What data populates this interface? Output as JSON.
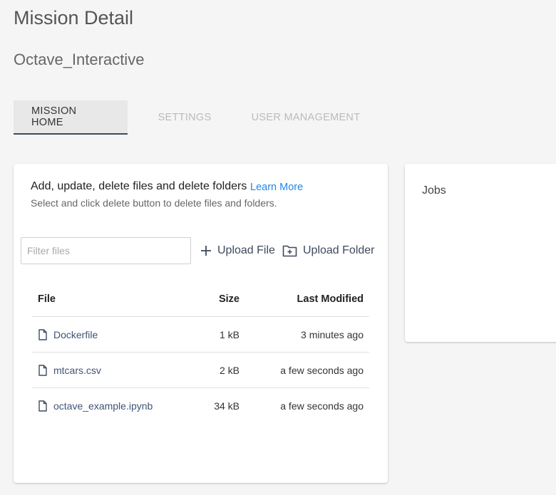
{
  "header": {
    "title": "Mission Detail",
    "mission_name": "Octave_Interactive"
  },
  "tabs": [
    {
      "label": "MISSION HOME",
      "active": true
    },
    {
      "label": "SETTINGS",
      "active": false
    },
    {
      "label": "USER MANAGEMENT",
      "active": false
    }
  ],
  "files_card": {
    "heading": "Add, update, delete files and delete folders",
    "learn_more": "Learn More",
    "subheading": "Select and click delete button to delete files and folders.",
    "filter": {
      "placeholder": "Filter files",
      "value": ""
    },
    "upload_file_label": "Upload File",
    "upload_folder_label": "Upload Folder",
    "upload_file_icon": "plus-icon",
    "upload_folder_icon": "folder-plus-icon",
    "table": {
      "columns": [
        "File",
        "Size",
        "Last Modified"
      ],
      "rows": [
        {
          "name": "Dockerfile",
          "size": "1 kB",
          "modified": "3 minutes ago",
          "icon": "file-icon"
        },
        {
          "name": "mtcars.csv",
          "size": "2 kB",
          "modified": "a few seconds ago",
          "icon": "file-icon"
        },
        {
          "name": "octave_example.ipynb",
          "size": "34 kB",
          "modified": "a few seconds ago",
          "icon": "file-icon"
        }
      ]
    }
  },
  "jobs_card": {
    "title": "Jobs"
  },
  "colors": {
    "accent": "#3f4a5e",
    "link": "#1e88e5",
    "background": "#f5f5f5"
  }
}
